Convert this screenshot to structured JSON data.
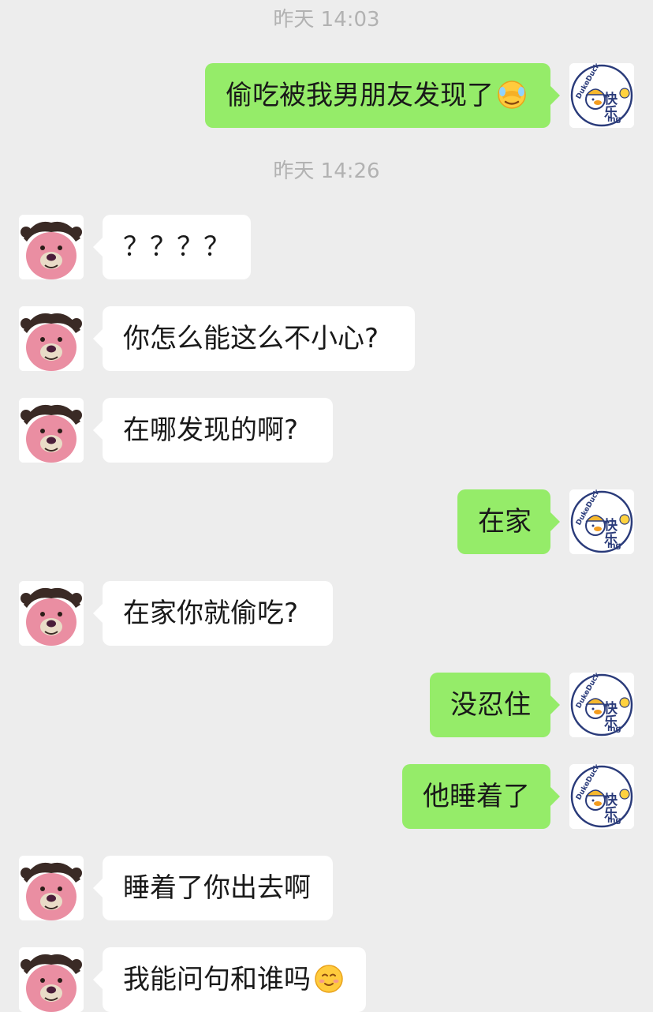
{
  "timestamps": [
    "昨天 14:03",
    "昨天 14:26"
  ],
  "messages": [
    {
      "sender": "me",
      "text": "偷吃被我男朋友发现了",
      "emoji": "face-with-hand-over-eyes-icon"
    },
    {
      "sender": "friend",
      "text": "？？？？"
    },
    {
      "sender": "friend",
      "text": "你怎么能这么不小心?"
    },
    {
      "sender": "friend",
      "text": "在哪发现的啊?"
    },
    {
      "sender": "me",
      "text": "在家"
    },
    {
      "sender": "friend",
      "text": "在家你就偷吃?"
    },
    {
      "sender": "me",
      "text": "没忍住"
    },
    {
      "sender": "me",
      "text": "他睡着了"
    },
    {
      "sender": "friend",
      "text": "睡着了你出去啊"
    },
    {
      "sender": "friend",
      "text": "我能问句和谁吗",
      "emoji": "smiling-face-icon"
    }
  ],
  "my_avatar": {
    "icon": "duck-avatar-icon",
    "text_main": "快乐",
    "text_top": "DukeDuck",
    "text_sub": "ing"
  },
  "friend_avatar": {
    "icon": "pink-bear-avatar-icon"
  },
  "colors": {
    "background": "#ededed",
    "outgoing_bubble": "#95ec69",
    "incoming_bubble": "#ffffff",
    "timestamp": "#b2b2b2"
  }
}
